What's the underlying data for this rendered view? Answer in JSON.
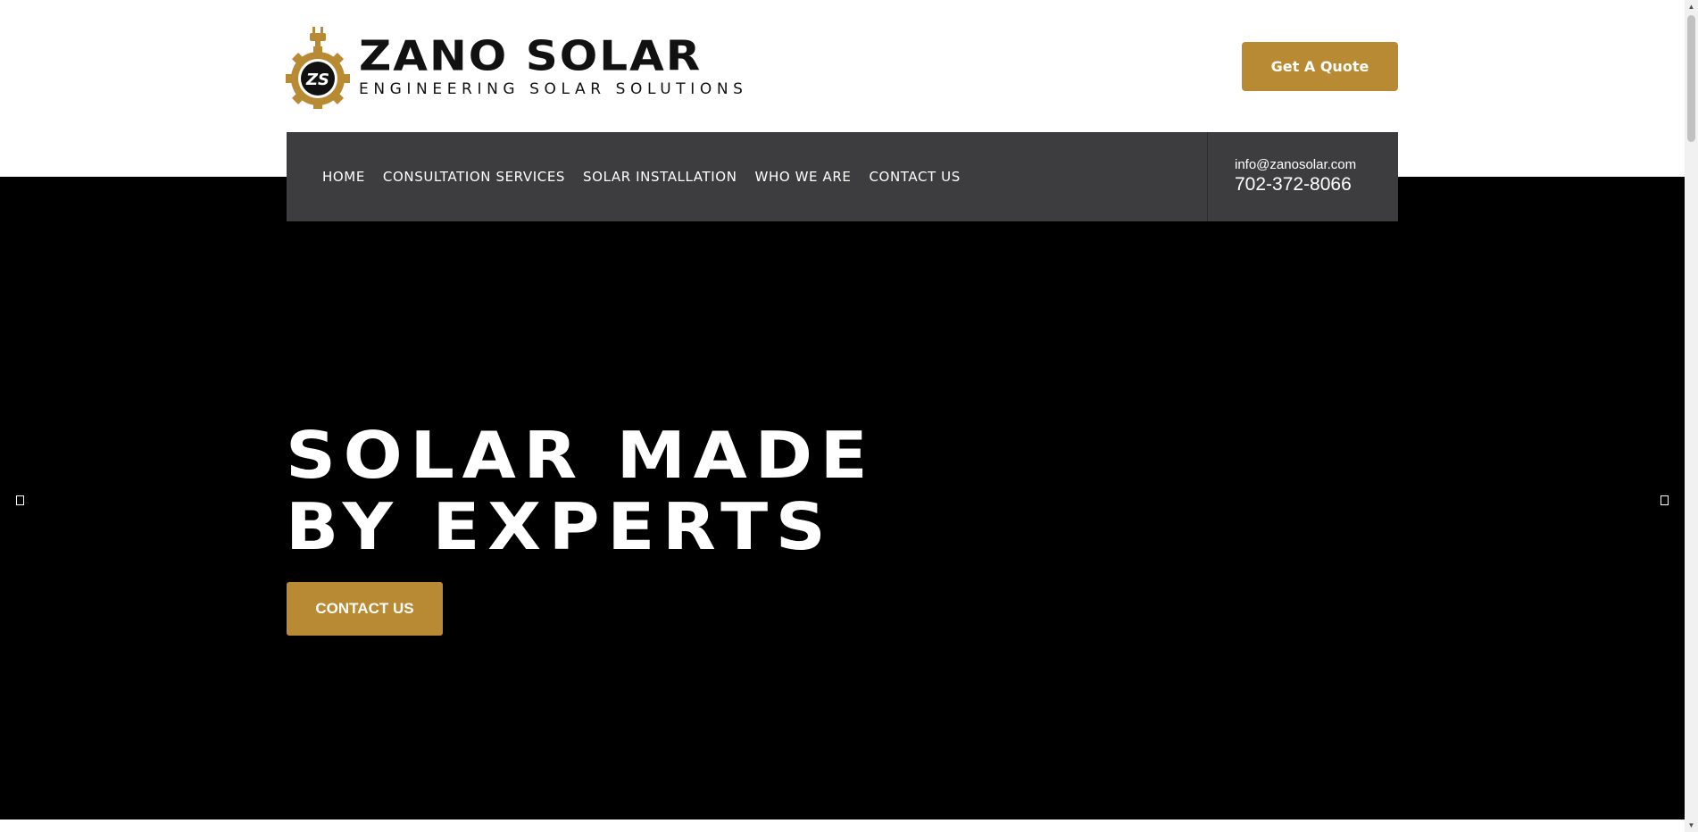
{
  "header": {
    "logo": {
      "monogram": "ZS",
      "name": "ZANO SOLAR",
      "tagline": "ENGINEERING SOLAR SOLUTIONS"
    },
    "quote_button": "Get A Quote"
  },
  "nav": {
    "items": [
      {
        "label": "HOME"
      },
      {
        "label": "CONSULTATION SERVICES"
      },
      {
        "label": "SOLAR INSTALLATION"
      },
      {
        "label": "WHO WE ARE"
      },
      {
        "label": "CONTACT US"
      }
    ],
    "email": "info@zanosolar.com",
    "phone": "702-372-8066"
  },
  "hero": {
    "headline_line1": "SOLAR MADE",
    "headline_line2": "BY EXPERTS",
    "cta": "CONTACT US"
  },
  "colors": {
    "accent": "#b88a33",
    "nav_bg": "#3d3d3f",
    "hero_bg": "#000000"
  }
}
